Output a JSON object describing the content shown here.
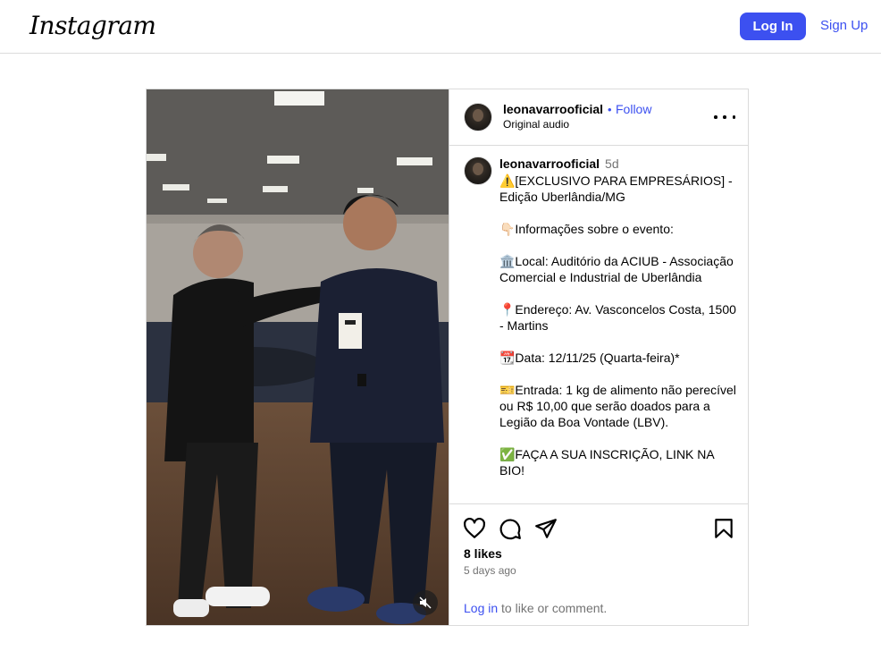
{
  "topbar": {
    "logo": "Instagram",
    "login_label": "Log In",
    "signup_label": "Sign Up"
  },
  "post": {
    "username": "leonavarrooficial",
    "separator": "•",
    "follow_label": "Follow",
    "audio_label": "Original audio",
    "caption": {
      "username": "leonavarrooficial",
      "time": "5d",
      "text": "⚠️[EXCLUSIVO PARA EMPRESÁRIOS] - Edição Uberlândia/MG\n\n👇🏻Informações sobre o evento:\n\n🏛️Local: Auditório da ACIUB - Associação Comercial e Industrial de Uberlândia\n\n📍Endereço: Av. Vasconcelos Costa, 1500 - Martins\n\n📆Data: 12/11/25 (Quarta-feira)*\n\n🎫Entrada: 1 kg de alimento não perecível ou R$ 10,00 que serão doados para a Legião da Boa Vontade (LBV).\n\n✅FAÇA A SUA INSCRIÇÃO, LINK NA BIO!"
    },
    "likes": "8 likes",
    "time_ago": "5 days ago",
    "login_link": "Log in",
    "login_suffix": " to like or comment."
  },
  "icons": {
    "like": "heart-icon",
    "comment": "comment-icon",
    "share": "share-icon",
    "save": "bookmark-icon",
    "more": "more-options-icon",
    "mute": "muted-speaker-icon"
  },
  "colors": {
    "accent": "#3c50f0",
    "border": "#dbdbdb",
    "muted_text": "#737373"
  }
}
